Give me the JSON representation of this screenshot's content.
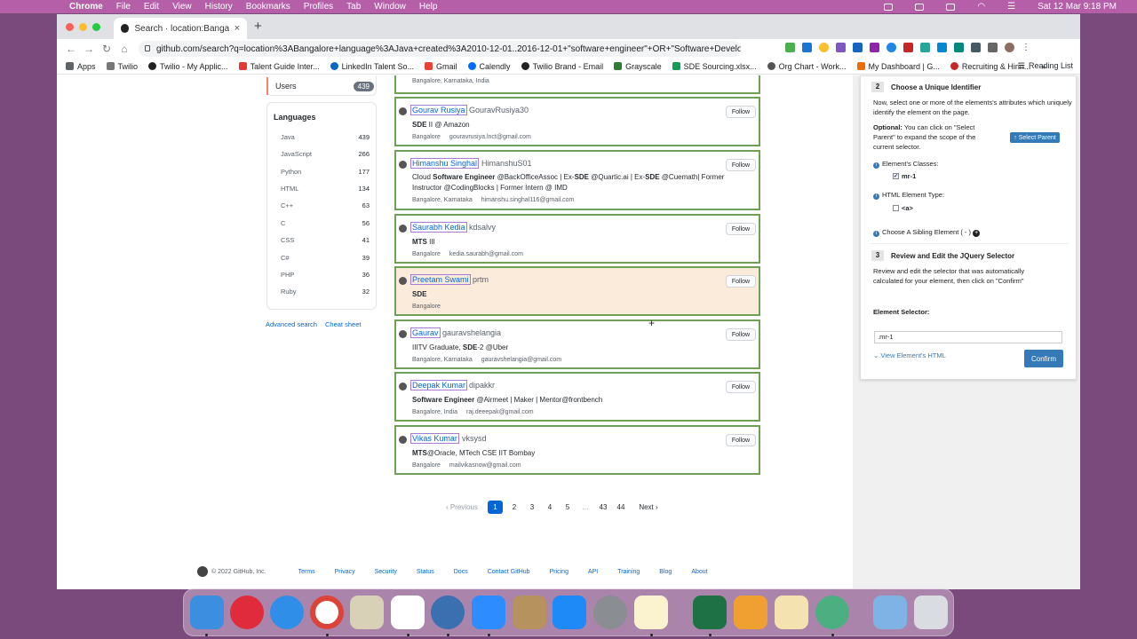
{
  "menubar": {
    "app": "Chrome",
    "items": [
      "File",
      "Edit",
      "View",
      "History",
      "Bookmarks",
      "Profiles",
      "Tab",
      "Window",
      "Help"
    ],
    "datetime": "Sat 12 Mar  9:18 PM"
  },
  "browser": {
    "tab_title": "Search · location:Bangalore la",
    "url": "github.com/search?q=location%3ABangalore+language%3AJava+created%3A2010-12-01..2016-12-01+\"software+engineer\"+OR+\"Software+Develo...",
    "bookmarks": [
      "Apps",
      "Twilio",
      "Twilio - My Applic...",
      "Talent Guide Inter...",
      "LinkedIn Talent So...",
      "Gmail",
      "Calendly",
      "Twilio Brand - Email",
      "Grayscale",
      "SDE Sourcing.xlsx...",
      "Org Chart - Work...",
      "My Dashboard | G...",
      "Recruiting & Hirin..."
    ],
    "more": "»",
    "reading_list": "Reading List"
  },
  "sidebar": {
    "users_label": "Users",
    "users_count": "439",
    "languages_title": "Languages",
    "languages": [
      {
        "name": "Java",
        "count": "439"
      },
      {
        "name": "JavaScript",
        "count": "266"
      },
      {
        "name": "Python",
        "count": "177"
      },
      {
        "name": "HTML",
        "count": "134"
      },
      {
        "name": "C++",
        "count": "63"
      },
      {
        "name": "C",
        "count": "56"
      },
      {
        "name": "CSS",
        "count": "41"
      },
      {
        "name": "C#",
        "count": "39"
      },
      {
        "name": "PHP",
        "count": "36"
      },
      {
        "name": "Ruby",
        "count": "32"
      }
    ],
    "advanced_search": "Advanced search",
    "cheat_sheet": "Cheat sheet"
  },
  "top_meta": "Bangalore, Karnataka, India",
  "users": [
    {
      "name": "Gourav Rusiya",
      "login": "GouravRusiya30",
      "bio_html": "<b>SDE</b> II @ Amazon",
      "location": "Bangalore",
      "email": "gouravrusiya.lnct@gmail.com"
    },
    {
      "name": "Himanshu Singhal",
      "login": "HimanshuS01",
      "bio_html": "Cloud <b>Software Engineer</b> @BackOfficeAssoc | Ex-<b>SDE</b> @Quartic.ai | Ex-<b>SDE</b> @Cuemath| Former Instructor @CodingBlocks | Former Intern @ IMD",
      "location": "Bangalore, Karnataka",
      "email": "himanshu.singhal116@gmail.com"
    },
    {
      "name": "Saurabh Kedia",
      "login": "kdsalvy",
      "bio_html": "<b>MTS</b> III",
      "location": "Bangalore",
      "email": "kedia.saurabh@gmail.com"
    },
    {
      "name": "Preetam Swami",
      "login": "prtm",
      "bio_html": "<b>SDE</b>",
      "location": "Bangalore",
      "email": ""
    },
    {
      "name": "Gaurav",
      "login": "gauravshelangia",
      "bio_html": "IIITV Graduate, <b>SDE</b>-2 @Uber",
      "location": "Bangalore, Karnataka",
      "email": "gauravshelangia@gmail.com"
    },
    {
      "name": "Deepak Kumar",
      "login": "dipakkr",
      "bio_html": "<b>Software Engineer</b> @Airmeet | Maker | Mentor@frontbench",
      "location": "Bangalore, India",
      "email": "raj.deeepak@gmail.com"
    },
    {
      "name": "Vikas Kumar",
      "login": "vksysd",
      "bio_html": "<b>MTS</b>@Oracle, MTech CSE IIT Bombay",
      "location": "Bangalore",
      "email": "mailvikasnow@gmail.com"
    }
  ],
  "follow_label": "Follow",
  "pagination": {
    "previous": "‹ Previous",
    "pages": [
      "1",
      "2",
      "3",
      "4",
      "5",
      "…",
      "43",
      "44"
    ],
    "current": "1",
    "next": "Next ›"
  },
  "footer": {
    "copyright": "© 2022 GitHub, Inc.",
    "links": [
      "Terms",
      "Privacy",
      "Security",
      "Status",
      "Docs",
      "Contact GitHub",
      "Pricing",
      "API",
      "Training",
      "Blog",
      "About"
    ]
  },
  "panel": {
    "step2_num": "2",
    "step2_title": "Choose a Unique Identifier",
    "step2_text": "Now, select one or more of the elements's attributes which uniquely identify the element on the page.",
    "optional_label": "Optional:",
    "optional_text": " You can click on \"Select Parent\" to expand the scope of the current selector.",
    "select_parent": "Select Parent",
    "classes_label": "Element's Classes:",
    "class_value": "mr-1",
    "type_label": "HTML Element Type:",
    "type_value": "<a>",
    "sibling_label": "Choose A Sibling Element ( - )",
    "step3_num": "3",
    "step3_title": "Review and Edit the JQuery Selector",
    "step3_text": "Review and edit the selector that was automatically calculated for your element, then click on \"Confirm\"",
    "selector_label": "Element Selector:",
    "selector_value": ".mr-1",
    "view_html": "View Element's HTML",
    "confirm": "Confirm"
  }
}
